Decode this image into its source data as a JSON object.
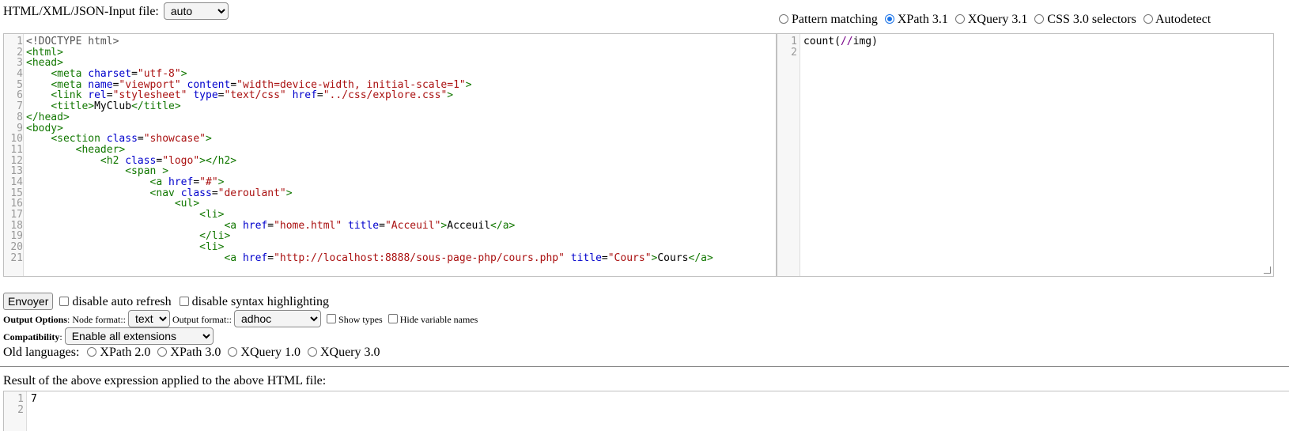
{
  "input_file": {
    "label": "HTML/XML/JSON-Input file:",
    "selected": "auto"
  },
  "query_modes": [
    {
      "label": "Pattern matching",
      "checked": false
    },
    {
      "label": "XPath 3.1",
      "checked": true
    },
    {
      "label": "XQuery 3.1",
      "checked": false
    },
    {
      "label": "CSS 3.0 selectors",
      "checked": false
    },
    {
      "label": "Autodetect",
      "checked": false
    }
  ],
  "html_editor": {
    "line_numbers": [
      "1",
      "2",
      "3",
      "4",
      "5",
      "6",
      "7",
      "8",
      "9",
      "10",
      "11",
      "12",
      "13",
      "14",
      "15",
      "16",
      "17",
      "18",
      "19",
      "20",
      "21"
    ]
  },
  "query_editor": {
    "line_numbers": [
      "1",
      "2"
    ],
    "code": {
      "fn": "count(",
      "axis": "//",
      "node": "img",
      "close": ")"
    }
  },
  "controls": {
    "submit_label": "Envoyer",
    "disable_auto_refresh": "disable auto refresh",
    "disable_syntax_highlighting": "disable syntax highlighting"
  },
  "output_options": {
    "label": "Output Options",
    "node_format_label": ": Node format::",
    "node_format_value": "text",
    "output_format_label": "Output format::",
    "output_format_value": "adhoc",
    "show_types": "Show types",
    "hide_variable_names": "Hide variable names"
  },
  "compatibility": {
    "label": "Compatibility",
    "sep": ":",
    "value": "Enable all extensions"
  },
  "old_languages": {
    "label": "Old languages:",
    "options": [
      "XPath 2.0",
      "XPath 3.0",
      "XQuery 1.0",
      "XQuery 3.0"
    ]
  },
  "result": {
    "title": "Result of the above expression applied to the above HTML file:",
    "line_numbers": [
      "1",
      "2"
    ],
    "value": "7"
  }
}
